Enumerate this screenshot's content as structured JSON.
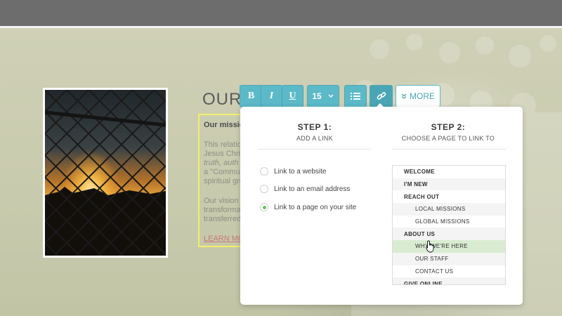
{
  "page": {
    "heading": "OUR",
    "text_lines": {
      "mission": "Our mission",
      "p2": [
        "This relatio",
        "Jesus Christ",
        "truth, auth",
        "a \"Commun",
        "spiritual gro"
      ],
      "p3": [
        "Our vision",
        "transforma",
        "transferred"
      ],
      "learn_more": "LEARN MO"
    }
  },
  "toolbar": {
    "bold": "B",
    "italic": "I",
    "underline": "U",
    "font_size": "15",
    "more": "MORE"
  },
  "link_panel": {
    "step1": {
      "title": "STEP 1:",
      "subtitle": "ADD A LINK"
    },
    "step2": {
      "title": "STEP 2:",
      "subtitle": "CHOOSE A PAGE TO LINK TO"
    },
    "options": [
      {
        "label": "Link to a website",
        "checked": false
      },
      {
        "label": "Link to an email address",
        "checked": false
      },
      {
        "label": "Link to a page on your site",
        "checked": true
      }
    ],
    "pages": [
      {
        "label": "WELCOME",
        "level": "top"
      },
      {
        "label": "I'M NEW",
        "level": "top"
      },
      {
        "label": "REACH OUT",
        "level": "top"
      },
      {
        "label": "LOCAL MISSIONS",
        "level": "sub"
      },
      {
        "label": "GLOBAL MISSIONS",
        "level": "sub"
      },
      {
        "label": "ABOUT US",
        "level": "top"
      },
      {
        "label": "WHY WE'RE HERE",
        "level": "sub",
        "selected": true
      },
      {
        "label": "OUR STAFF",
        "level": "sub"
      },
      {
        "label": "CONTACT US",
        "level": "sub"
      },
      {
        "label": "GIVE ONLINE",
        "level": "top"
      }
    ]
  },
  "colors": {
    "accent": "#5bb9c8",
    "selected_row": "#d9ecd2",
    "radio_checked": "#68c25e",
    "highlight_border": "#f2ef6a"
  },
  "icons": {
    "dropdown": "chevron-down-icon",
    "list": "list-icon",
    "link": "link-icon",
    "more": "double-chevron-down-icon",
    "cursor": "hand-pointer-icon"
  }
}
